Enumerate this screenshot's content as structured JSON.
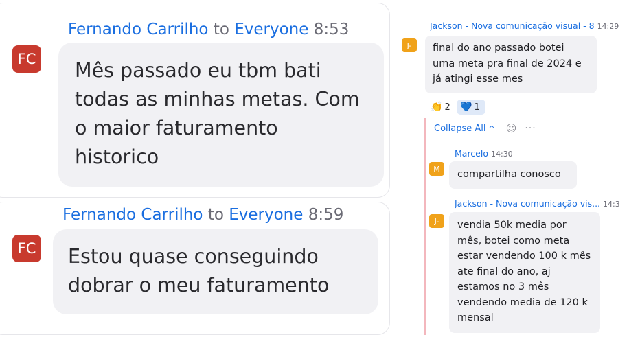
{
  "left_messages": [
    {
      "sender": "Fernando Carrilho",
      "to_word": "to",
      "recipient": "Everyone",
      "time": "8:53",
      "avatar_initials": "FC",
      "lines": [
        "Mês passado eu tbm bati",
        "todas as minhas metas. Com",
        "o maior faturamento",
        "historico"
      ]
    },
    {
      "sender": "Fernando Carrilho",
      "to_word": "to",
      "recipient": "Everyone",
      "time": "8:59",
      "avatar_initials": "FC",
      "lines": [
        "Estou quase conseguindo",
        "dobrar o meu faturamento"
      ]
    }
  ],
  "thread": {
    "root": {
      "sender": "Jackson - Nova comunicação visual - 8",
      "time": "14:29",
      "avatar_initials": "J-",
      "lines": [
        "final do ano passado botei",
        "uma meta pra final de 2024 e",
        "já atingi esse mes"
      ]
    },
    "reactions": [
      {
        "emoji": "👏",
        "count": "2",
        "icon": "clapping-hands-icon"
      },
      {
        "emoji": "💙",
        "count": "1",
        "icon": "blue-heart-icon"
      }
    ],
    "collapse_label": "Collapse All",
    "collapse_chevron": "^",
    "emoji_button": "☺",
    "more_button": "···",
    "replies": [
      {
        "sender": "Marcelo",
        "time": "14:30",
        "avatar_initials": "M",
        "lines": [
          "compartilha conosco"
        ]
      },
      {
        "sender": "Jackson - Nova comunicação vis...",
        "time": "14:3",
        "avatar_initials": "J-",
        "lines": [
          "vendia 50k media por",
          "mês, botei como meta",
          "estar vendendo 100 k mês",
          "ate final do ano, aj",
          "estamos no 3 mês",
          "vendendo media de 120 k",
          "mensal"
        ]
      }
    ]
  },
  "colors": {
    "link_blue": "#1a6ee0",
    "fc_avatar": "#c83a2e",
    "j_avatar": "#f0a21a",
    "bubble": "#f1f1f4",
    "thread_line": "#f3b7bd"
  }
}
